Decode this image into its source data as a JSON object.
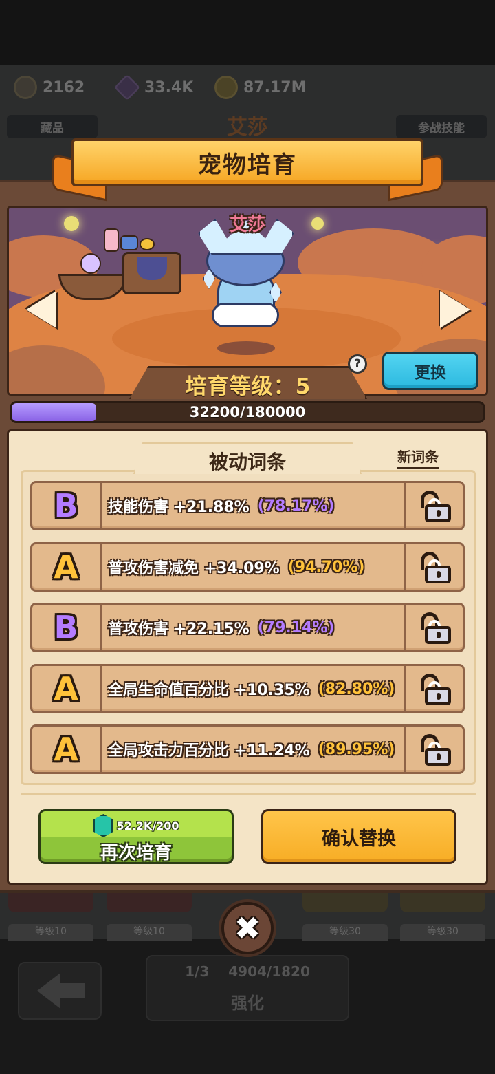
{
  "background": {
    "currencies": [
      {
        "icon": "key-pouch-icon",
        "value": "2162"
      },
      {
        "icon": "purple-cube-icon",
        "value": "33.4K"
      },
      {
        "icon": "gold-coin-icon",
        "value": "87.17M"
      }
    ],
    "left_tab": "藏品",
    "pet_name": "艾莎",
    "right_tab": "参战技能",
    "level_tags": [
      "等级10",
      "等级10",
      "等级30",
      "等级30"
    ],
    "enhance": {
      "shards": "1/3",
      "bones": "4904/1820",
      "label": "强化"
    }
  },
  "modal": {
    "title": "宠物培育",
    "pet_name": "艾莎",
    "training_level_label": "培育等级：5",
    "help_label": "?",
    "swap_label": "更换",
    "progress": {
      "text": "32200/180000",
      "current": 32200,
      "max": 180000
    },
    "section_title": "被动词条",
    "new_affix_label": "新词条",
    "affixes": [
      {
        "grade": "B",
        "text": "技能伤害 +21.88%",
        "percent": "(78.17%)",
        "grade_color": "#b47cff"
      },
      {
        "grade": "A",
        "text": "普攻伤害减免 +34.09%",
        "percent": "(94.70%)",
        "grade_color": "#ffc23a"
      },
      {
        "grade": "B",
        "text": "普攻伤害 +22.15%",
        "percent": "(79.14%)",
        "grade_color": "#b47cff"
      },
      {
        "grade": "A",
        "text": "全局生命值百分比 +10.35%",
        "percent": "(82.80%)",
        "grade_color": "#ffc23a"
      },
      {
        "grade": "A",
        "text": "全局攻击力百分比 +11.24%",
        "percent": "(89.95%)",
        "grade_color": "#ffc23a"
      }
    ],
    "retrain": {
      "cost": "52.2K/200",
      "label": "再次培育",
      "cost_icon": "green-gem-icon"
    },
    "confirm_label": "确认替换",
    "close_icon": "close-icon"
  }
}
